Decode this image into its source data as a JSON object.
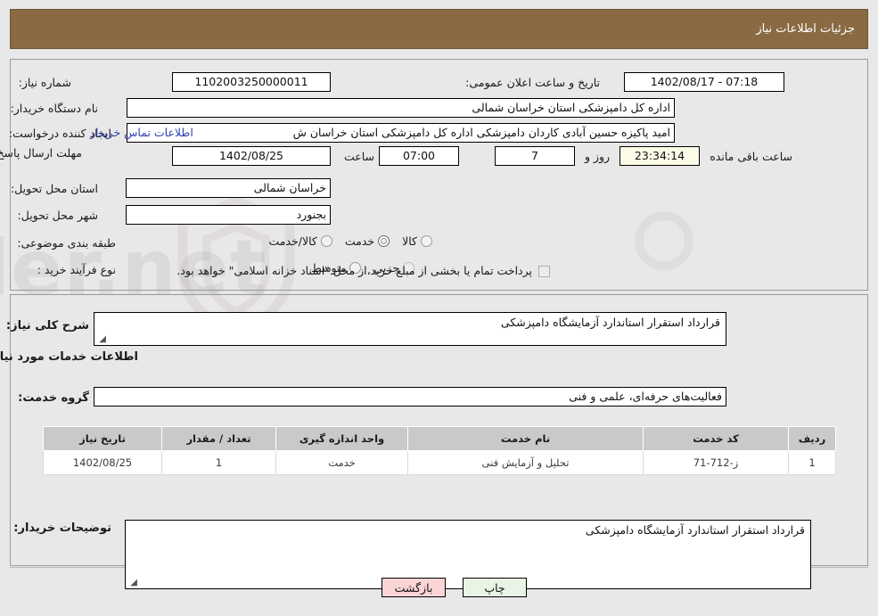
{
  "header": {
    "title": "جزئیات اطلاعات نیاز",
    "bar_color": "#8a6a43"
  },
  "form": {
    "need_number_label": "شماره نیاز:",
    "need_number_value": "1102003250000011",
    "announce_datetime_label": "تاریخ و ساعت اعلان عمومی:",
    "announce_datetime_value": "1402/08/17 - 07:18",
    "buyer_org_label": "نام دستگاه خریدار:",
    "buyer_org_value": "اداره کل دامپزشکی استان خراسان شمالی",
    "requester_label": "ایجاد کننده درخواست:",
    "requester_value": "امید پاکیزه حسین آبادی کاردان دامپزشکی اداره کل دامپزشکی استان خراسان ش",
    "buyer_contact_link": "اطلاعات تماس خریدار",
    "deadline_label": "مهلت ارسال پاسخ: تا تاریخ:",
    "deadline_date_value": "1402/08/25",
    "hour_label": "ساعت",
    "hour_value": "07:00",
    "days_value": "7",
    "days_and_label": "روز و",
    "timer_value": "23:34:14",
    "remaining_label": "ساعت باقی مانده",
    "province_label": "استان محل تحویل:",
    "province_value": "خراسان شمالی",
    "city_label": "شهر محل تحویل:",
    "city_value": "بجنورد",
    "category_label": "طبقه بندی موضوعی:",
    "category_options": [
      {
        "label": "کالا",
        "selected": false
      },
      {
        "label": "خدمت",
        "selected": true
      },
      {
        "label": "کالا/خدمت",
        "selected": false
      }
    ],
    "process_label": "نوع فرآیند خرید :",
    "process_options": [
      {
        "label": "جزیی",
        "selected": false
      },
      {
        "label": "متوسط",
        "selected": false
      }
    ],
    "treasury_checkbox_text": "پرداخت تمام یا بخشی از مبلغ خرید،از محل \"اسناد خزانه اسلامی\" خواهد بود.",
    "treasury_checked": false
  },
  "need_summary": {
    "label": "شرح کلی نیاز:",
    "value": "قرارداد استقرار استاندارد آزمایشگاه دامپزشکی"
  },
  "services_section": {
    "heading": "اطلاعات خدمات مورد نیاز",
    "service_group_label": "گروه خدمت:",
    "service_group_value": "فعالیت‌های حرفه‌ای، علمی و فنی"
  },
  "services_table": {
    "columns": [
      "ردیف",
      "کد خدمت",
      "نام خدمت",
      "واحد اندازه گیری",
      "تعداد / مقدار",
      "تاریخ نیاز"
    ],
    "rows": [
      {
        "row": "1",
        "code": "ز-712-71",
        "name": "تحلیل و آزمایش فنی",
        "unit": "خدمت",
        "quantity": "1",
        "need_date": "1402/08/25"
      }
    ]
  },
  "buyer_notes": {
    "label": "توضیحات خریدار:",
    "value": "قرارداد استقرار استاندارد آزمایشگاه دامپزشکی"
  },
  "footer": {
    "print_label": "چاپ",
    "back_label": "بازگشت",
    "print_color": "#e8f5e4",
    "back_color": "#fbd5d5"
  },
  "watermark": {
    "text": "AriaTender.net"
  }
}
